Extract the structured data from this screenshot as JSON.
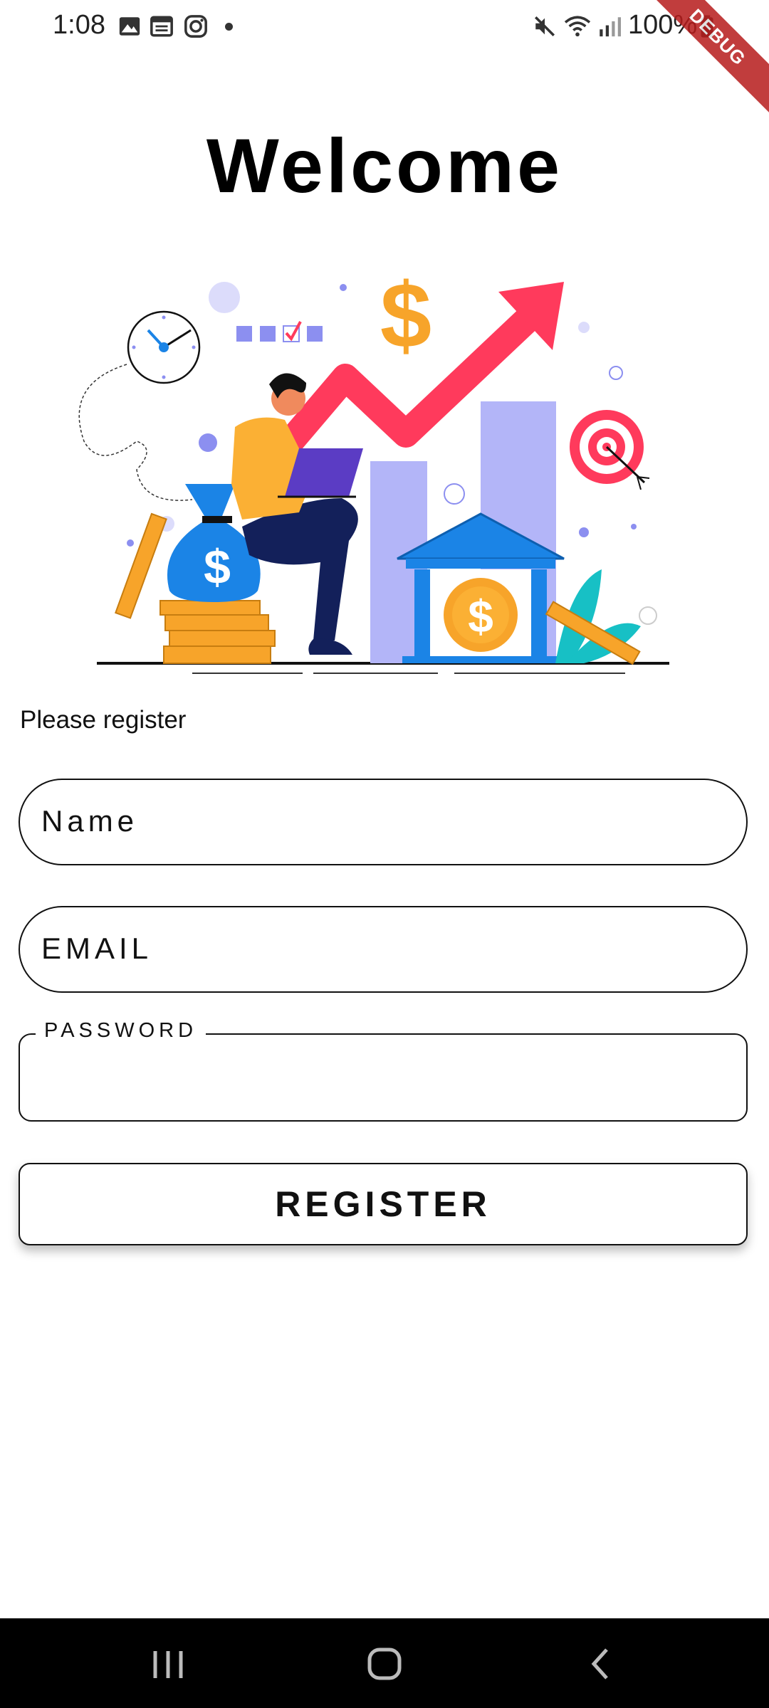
{
  "status_bar": {
    "time": "1:08",
    "battery": "100%",
    "icons": [
      "gallery-icon",
      "calendar-icon",
      "instagram-icon",
      "mute-icon",
      "wifi-icon",
      "signal-icon",
      "battery-icon"
    ]
  },
  "debug_banner": "DEBUG",
  "title": "Welcome",
  "prompt": "Please register",
  "form": {
    "name_placeholder": "Name",
    "email_placeholder": "EMAIL",
    "password_label": "PASSWORD",
    "password_value": "",
    "register_label": "REGISTER"
  },
  "colors": {
    "accent_red": "#ff3a5c",
    "coin_orange": "#f7a42a",
    "bar_lavender": "#b3b5f8",
    "bank_blue": "#1b84e6",
    "navy": "#13205a",
    "shirt_orange": "#fbb034",
    "laptop_purple": "#5b3cc4",
    "leaf_teal": "#17c0c5"
  },
  "nav_bar": {
    "icons": [
      "recent-apps-icon",
      "home-icon",
      "back-icon"
    ]
  }
}
